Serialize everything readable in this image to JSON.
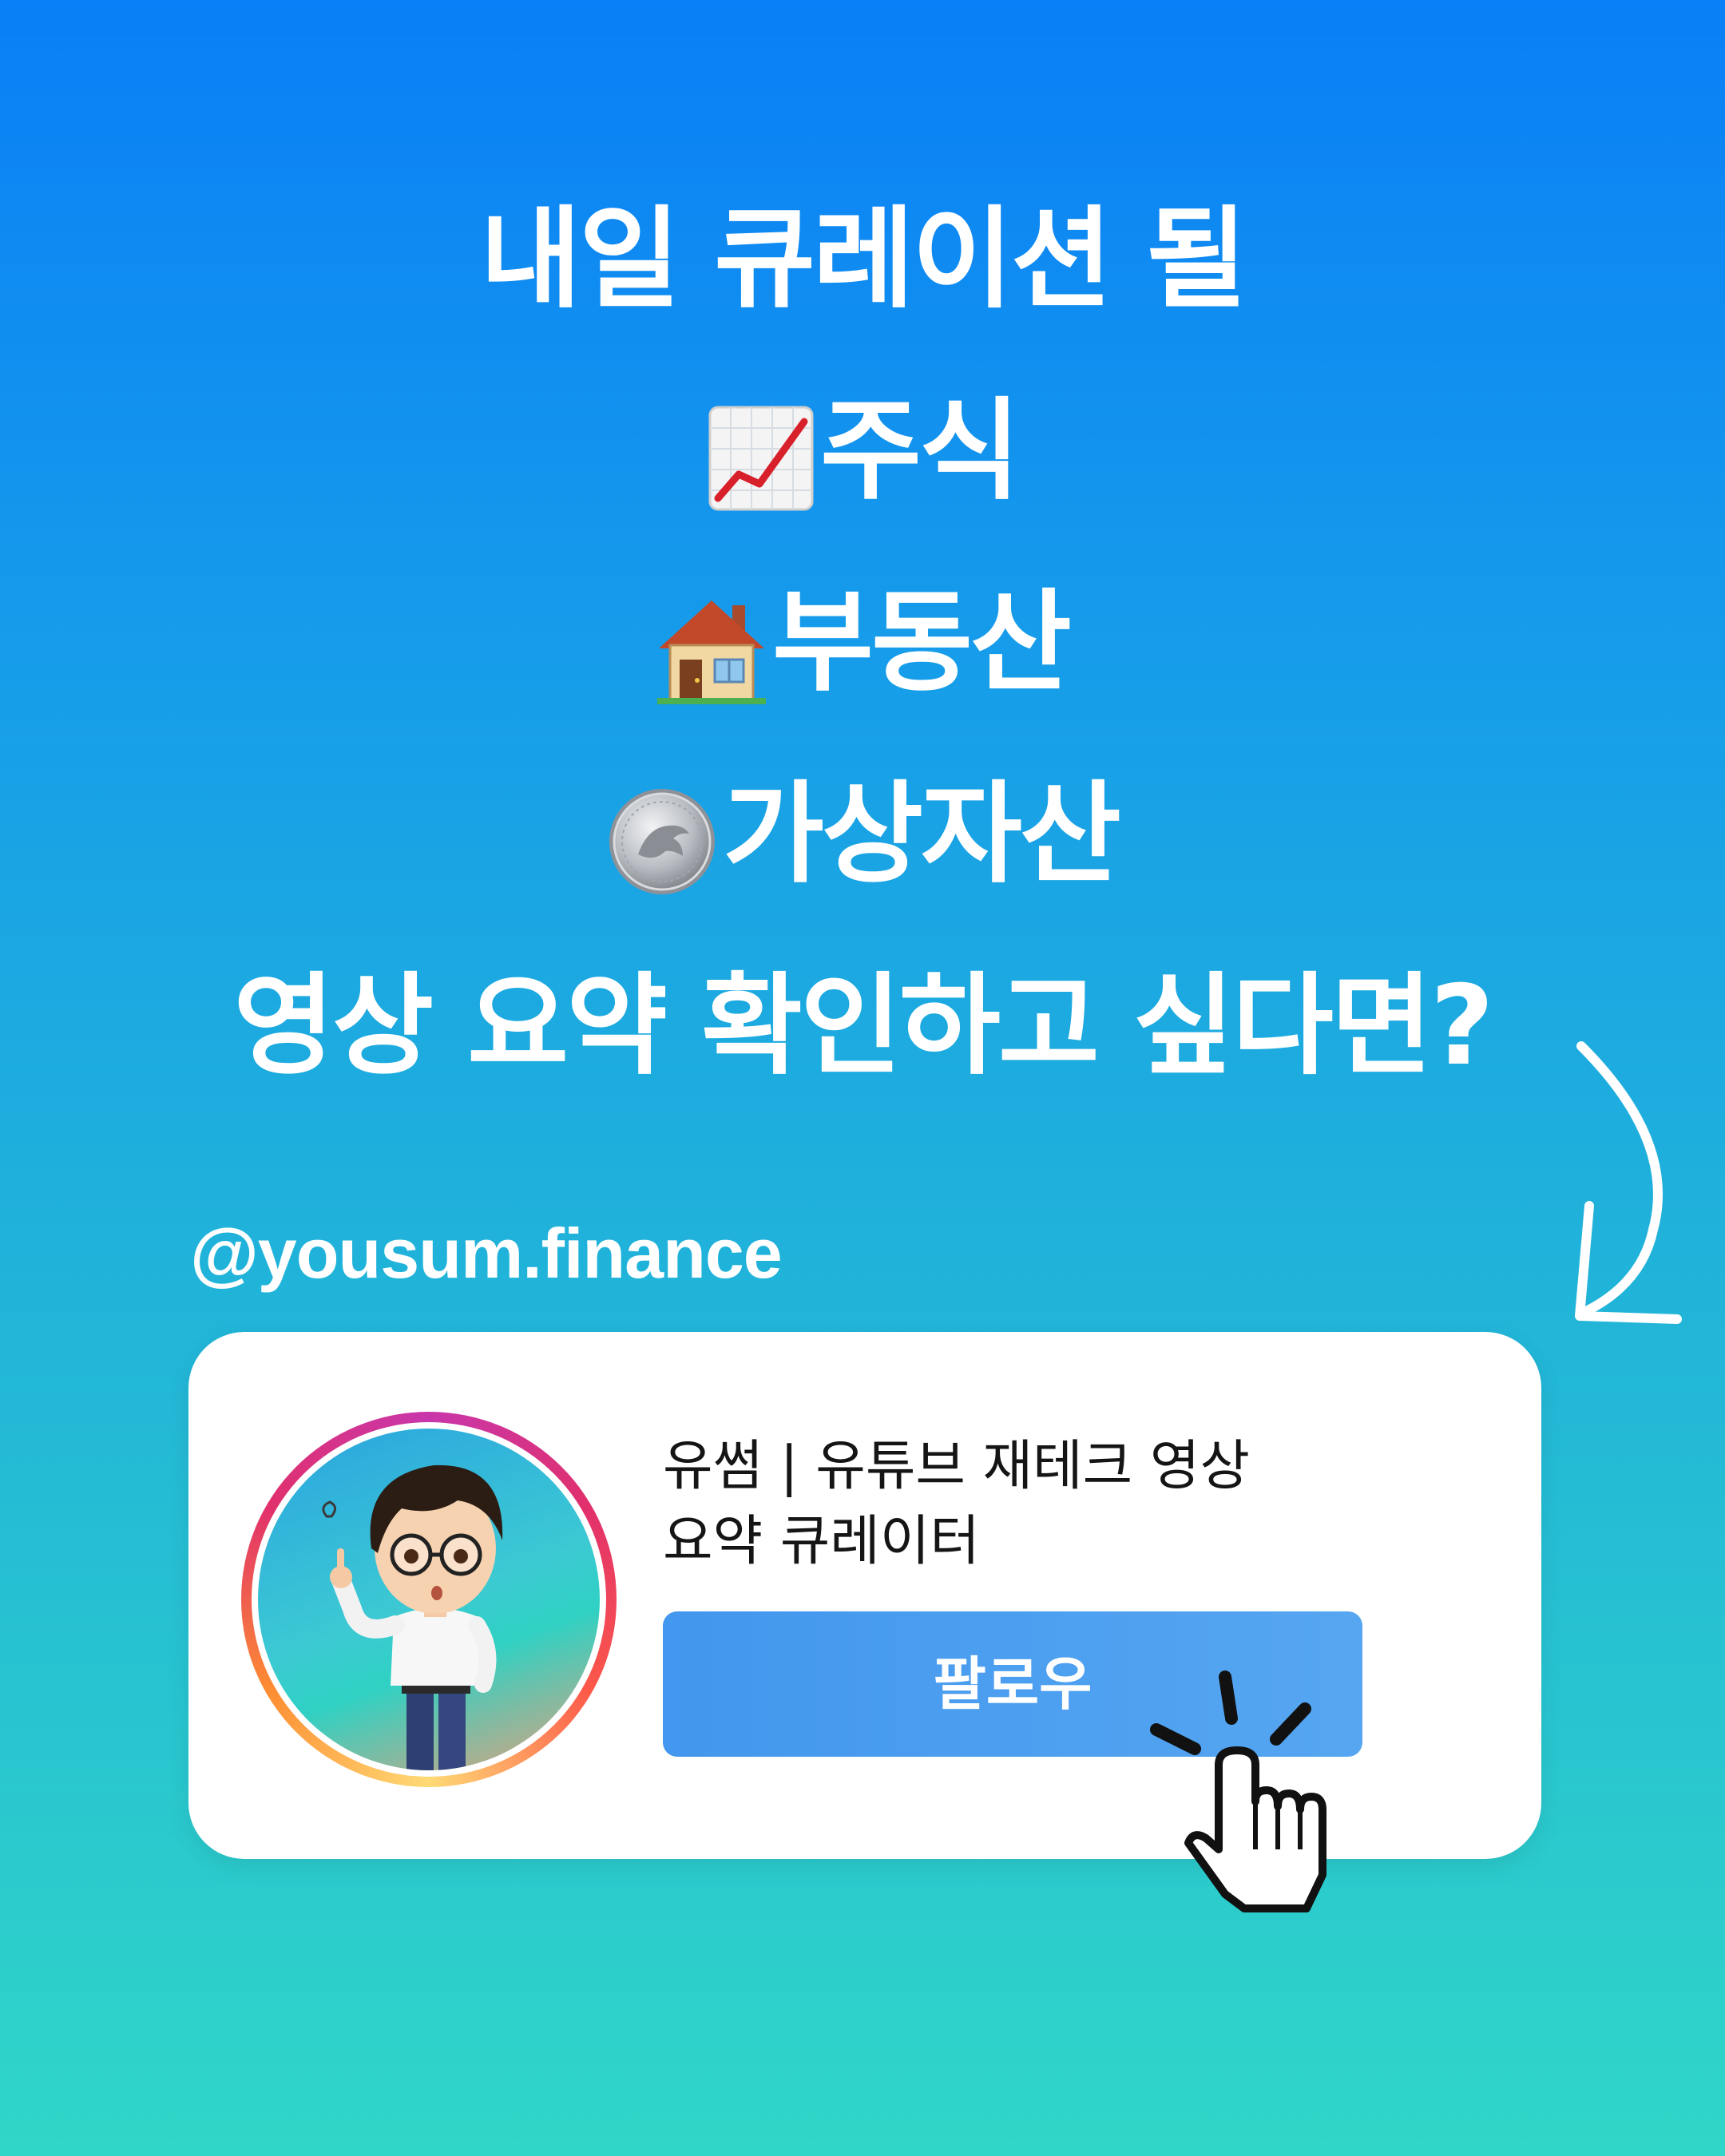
{
  "headline": {
    "line1": "내일 큐레이션 될",
    "line2": "주식",
    "line3": "부동산",
    "line4": "가상자산",
    "line5": "영상 요약 확인하고 싶다면?"
  },
  "icons": {
    "line2": "chart-increasing-icon",
    "line3": "house-icon",
    "line4": "coin-icon"
  },
  "handle": "@yousum.finance",
  "profile_card": {
    "bio_line1": "유썸 | 유튜브 재테크 영상",
    "bio_line2": "요약 큐레이터",
    "follow_label": "팔로우"
  },
  "colors": {
    "background_top": "#0a7ff7",
    "background_bottom": "#30d6c7",
    "follow_button": "#4a9cef"
  }
}
